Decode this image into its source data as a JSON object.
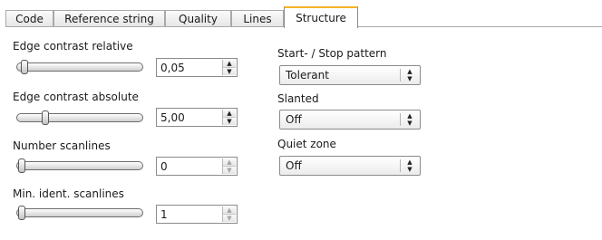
{
  "tabs": [
    {
      "label": "Code",
      "active": false
    },
    {
      "label": "Reference string",
      "active": false
    },
    {
      "label": "Quality",
      "active": false
    },
    {
      "label": "Lines",
      "active": false
    },
    {
      "label": "Structure",
      "active": true
    }
  ],
  "left": {
    "edge_contrast_relative": {
      "label": "Edge contrast relative",
      "value": "0,05",
      "slider_level": 0.02
    },
    "edge_contrast_absolute": {
      "label": "Edge contrast absolute",
      "value": "5,00",
      "slider_level": 0.2
    },
    "number_scanlines": {
      "label": "Number scanlines",
      "value": "0",
      "slider_level": 0.0
    },
    "min_ident_scanlines": {
      "label": "Min. ident. scanlines",
      "value": "1",
      "slider_level": 0.0
    }
  },
  "right": {
    "start_stop_pattern": {
      "label": "Start- / Stop pattern",
      "value": "Tolerant"
    },
    "slanted": {
      "label": "Slanted",
      "value": "Off"
    },
    "quiet_zone": {
      "label": "Quiet zone",
      "value": "Off"
    }
  },
  "colors": {
    "active_tab_accent": "#f5b326",
    "border": "#8b8b8b"
  },
  "icons": {
    "spin_up": "up-arrow-icon",
    "spin_down": "down-arrow-icon",
    "combo": "updown-arrow-icon"
  }
}
